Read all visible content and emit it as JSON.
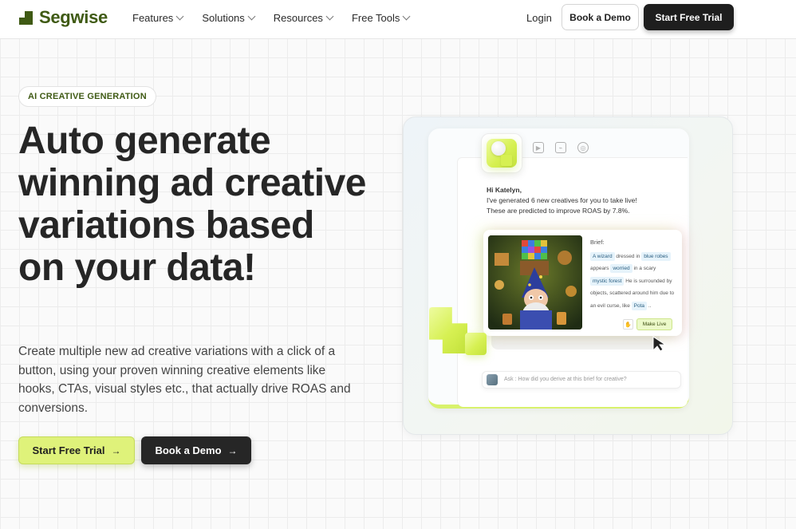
{
  "nav": {
    "brand": "Segwise",
    "menu": [
      {
        "label": "Features"
      },
      {
        "label": "Solutions"
      },
      {
        "label": "Resources"
      },
      {
        "label": "Free Tools"
      }
    ],
    "login": "Login",
    "book_demo": "Book a Demo",
    "start_trial": "Start Free Trial"
  },
  "hero": {
    "badge": "AI CREATIVE GENERATION",
    "headline": "Auto generate winning ad creative variations based on your data!",
    "subtext": "Create multiple new ad creative variations with a click of a button, using your proven winning creative elements like hooks, CTAs, visual styles etc., that actually drive ROAS and conversions.",
    "cta_primary": "Start Free Trial",
    "cta_secondary": "Book a Demo",
    "arrow": "→"
  },
  "illustration": {
    "greeting": "Hi Katelyn,",
    "message_line1": "I've generated 6 new creatives for you to take live!",
    "message_line2": "These are predicted to improve ROAS by 7.8%.",
    "brief_label": "Brief:",
    "brief_tag1": "A wizard",
    "brief_t1": "dressed in",
    "brief_tag2": "blue robes",
    "brief_t2": "appears",
    "brief_tag3": "worried",
    "brief_t3": "in a scary",
    "brief_tag4": "mystic forest",
    "brief_t4": "He is surrounded by objects, scattered around him due to an evil curse, like",
    "brief_tag5": "Pota",
    "brief_t5": "..",
    "make_live": "Make Live",
    "ask_placeholder": "Ask : How did you derive at this brief for creative?",
    "icons": [
      "play-file-icon",
      "presentation-icon",
      "target-icon"
    ],
    "accent": "#d8f26c"
  },
  "colors": {
    "brand": "#3f5a14",
    "primary_cta": "#dff27a",
    "dark": "#1e1e1e"
  }
}
